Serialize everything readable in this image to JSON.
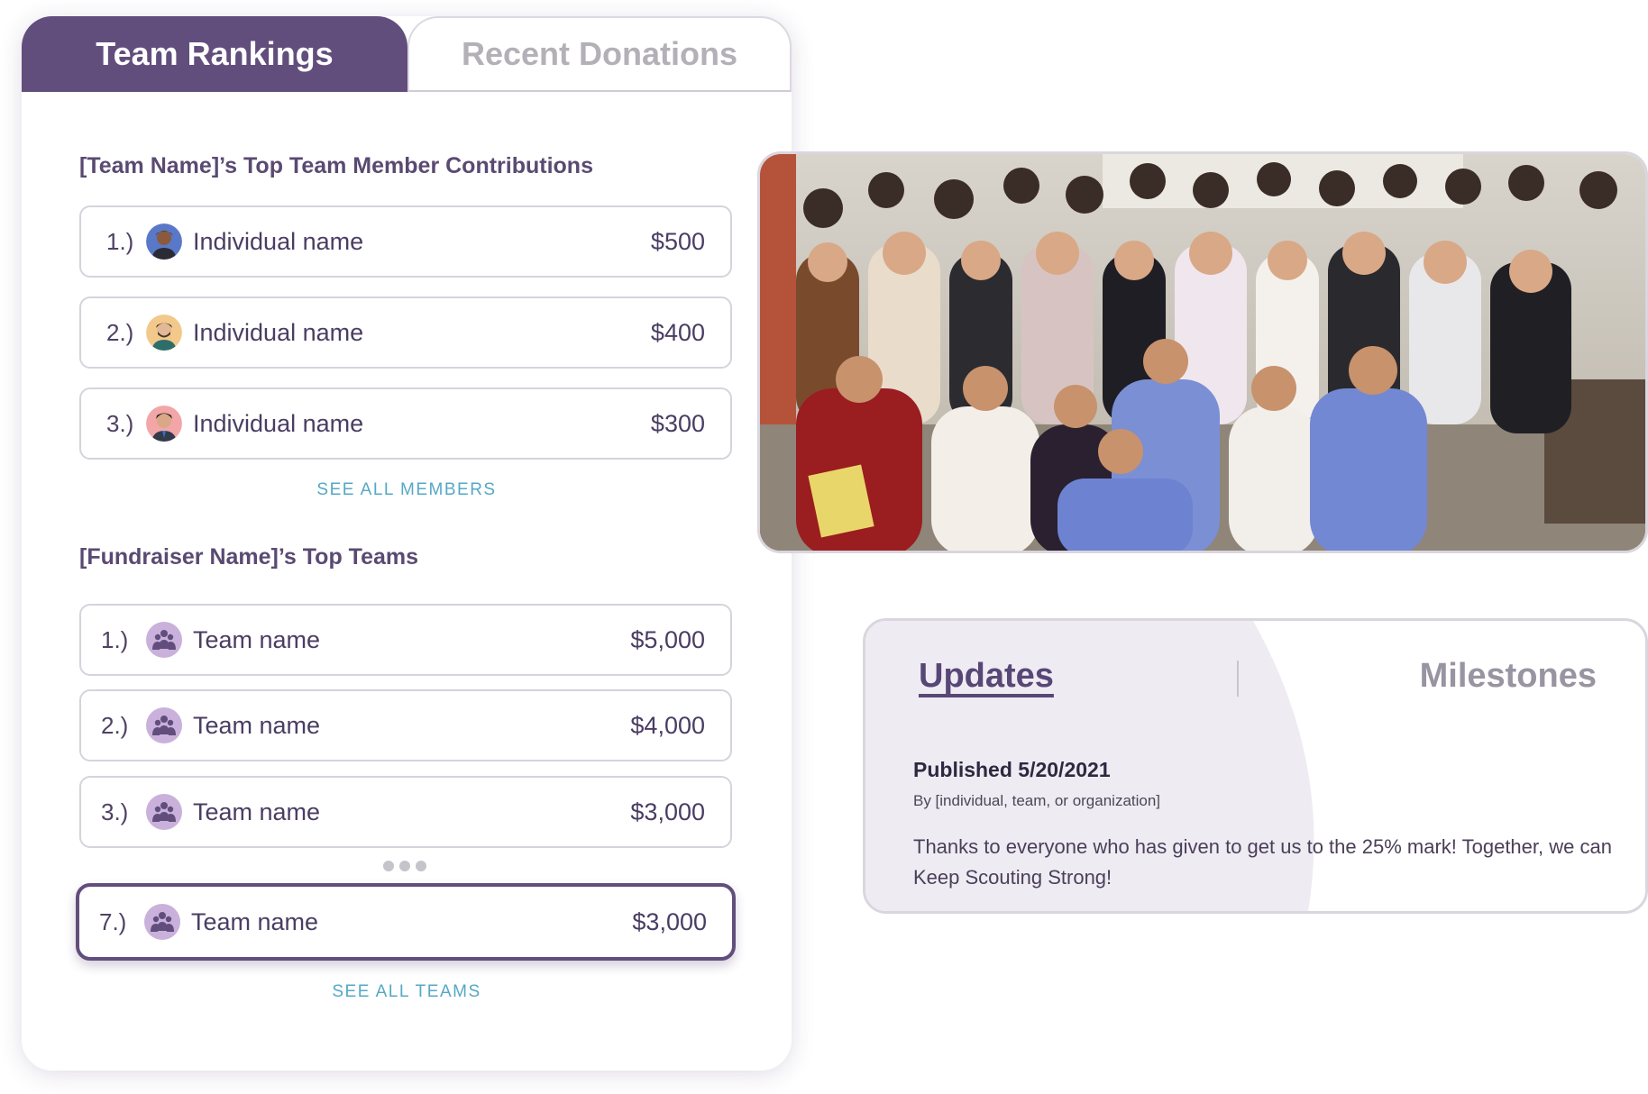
{
  "tabs": {
    "active": "Team Rankings",
    "inactive": "Recent Donations"
  },
  "members_section": {
    "title": "[Team Name]’s Top Team Member Contributions",
    "rows": [
      {
        "rank": "1.)",
        "name": "Individual name",
        "amount": "$500"
      },
      {
        "rank": "2.)",
        "name": "Individual name",
        "amount": "$400"
      },
      {
        "rank": "3.)",
        "name": "Individual name",
        "amount": "$300"
      }
    ],
    "see_all": "SEE ALL MEMBERS"
  },
  "teams_section": {
    "title": "[Fundraiser Name]’s Top Teams",
    "rows": [
      {
        "rank": "1.)",
        "name": "Team name",
        "amount": "$5,000"
      },
      {
        "rank": "2.)",
        "name": "Team name",
        "amount": "$4,000"
      },
      {
        "rank": "3.)",
        "name": "Team name",
        "amount": "$3,000"
      }
    ],
    "highlighted_row": {
      "rank": "7.)",
      "name": "Team name",
      "amount": "$3,000"
    },
    "see_all": "SEE ALL TEAMS"
  },
  "updates": {
    "tab_updates": "Updates",
    "tab_milestones": "Milestones",
    "published": "Published 5/20/2021",
    "byline": "By [individual, team, or organization]",
    "message": "Thanks to everyone who has given to get us to the 25% mark! Together, we can Keep Scouting Strong!"
  },
  "colors": {
    "brand_purple": "#624e7c",
    "link_blue": "#56a8c6",
    "team_icon_bg": "#c9b1dc"
  },
  "icons": {
    "team": "people-group-icon"
  }
}
